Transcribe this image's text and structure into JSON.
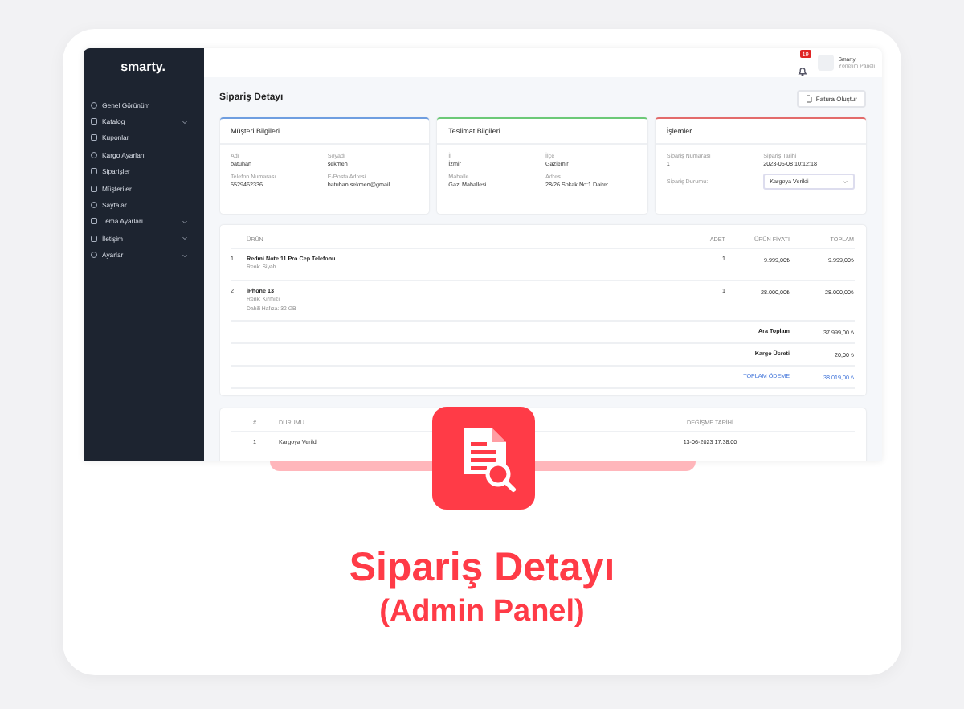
{
  "brand": "smarty.",
  "sidebar": {
    "items": [
      {
        "label": "Genel Görünüm",
        "expandable": false
      },
      {
        "label": "Katalog",
        "expandable": true
      },
      {
        "label": "Kuponlar",
        "expandable": false
      },
      {
        "label": "Kargo Ayarları",
        "expandable": false
      },
      {
        "label": "Siparişler",
        "expandable": false
      },
      {
        "label": "Müşteriler",
        "expandable": false
      },
      {
        "label": "Sayfalar",
        "expandable": false
      },
      {
        "label": "Tema Ayarları",
        "expandable": true
      },
      {
        "label": "İletişim",
        "expandable": true
      },
      {
        "label": "Ayarlar",
        "expandable": true
      }
    ]
  },
  "topbar": {
    "notification_count": "19",
    "user_name": "Smarty",
    "user_role": "Yönetim Paneli"
  },
  "page_title": "Sipariş Detayı",
  "invoice_button": "Fatura Oluştur",
  "cards": [
    {
      "title": "Müşteri Bilgileri",
      "color": "#6f9ee0",
      "fields": [
        {
          "label": "Adı",
          "value": "batuhan"
        },
        {
          "label": "Soyadı",
          "value": "sekmen"
        },
        {
          "label": "Telefon Numarası",
          "value": "5529462336"
        },
        {
          "label": "E-Posta Adresi",
          "value": "batuhan.sekmen@gmail...."
        }
      ]
    },
    {
      "title": "Teslimat Bilgileri",
      "color": "#6cc977",
      "fields": [
        {
          "label": "İl",
          "value": "İzmir"
        },
        {
          "label": "İlçe",
          "value": "Gaziemir"
        },
        {
          "label": "Mahalle",
          "value": "Gazi Mahallesi"
        },
        {
          "label": "Adres",
          "value": "28/26 Sokak No:1 Daire:..."
        }
      ]
    },
    {
      "title": "İşlemler",
      "color": "#e36b6b",
      "fields": [
        {
          "label": "Sipariş Numarası",
          "value": "1"
        },
        {
          "label": "Sipariş Tarihi",
          "value": "2023-06-08 10:12:18"
        }
      ],
      "status_label": "Sipariş Durumu:",
      "status_value": "Kargoya Verildi"
    }
  ],
  "items": {
    "columns": [
      "ÜRÜN",
      "ADET",
      "ÜRÜN FİYATI",
      "TOPLAM"
    ],
    "rows": [
      {
        "no": "1",
        "name": "Redmi Note 11 Pro Cep Telefonu",
        "details": [
          "Renk: Siyah"
        ],
        "qty": "1",
        "price": "9.999,00₺",
        "total": "9.999,00₺"
      },
      {
        "no": "2",
        "name": "iPhone 13",
        "details": [
          "Renk: Kırmızı",
          "Dahili Hafıza: 32 GB"
        ],
        "qty": "1",
        "price": "28.000,00₺",
        "total": "28.000,00₺"
      }
    ],
    "totals": [
      {
        "label": "Ara Toplam",
        "value": "37.999,00 ₺",
        "kind": "normal"
      },
      {
        "label": "Kargo Ücreti",
        "value": "20,00 ₺",
        "kind": "normal"
      },
      {
        "label": "TOPLAM ÖDEME",
        "value": "38.019,00 ₺",
        "kind": "grand"
      }
    ]
  },
  "history": {
    "columns": [
      "#",
      "DURUMU",
      "DEĞİŞME TARİHİ"
    ],
    "rows": [
      {
        "no": "1",
        "status": "Kargoya Verildi",
        "date": "13-06-2023 17:38:00"
      }
    ]
  },
  "headline": "Sipariş Detayı",
  "subtitle": "(Admin Panel)"
}
